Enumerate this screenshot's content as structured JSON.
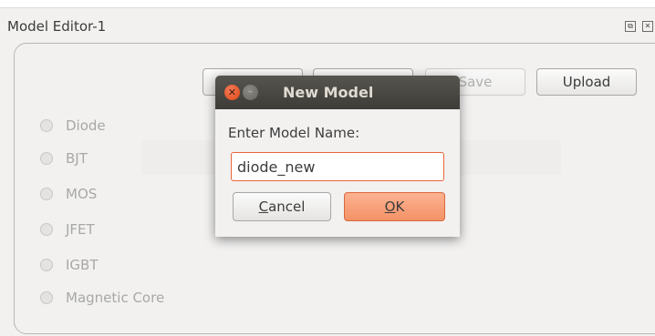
{
  "panel": {
    "title": "Model Editor-1",
    "float_glyph": "⧉",
    "close_glyph": "✕"
  },
  "toolbar": {
    "save_label": "Save",
    "upload_label": "Upload"
  },
  "model_types": [
    {
      "label": "Diode"
    },
    {
      "label": "BJT"
    },
    {
      "label": "MOS"
    },
    {
      "label": "JFET"
    },
    {
      "label": "IGBT"
    },
    {
      "label": "Magnetic Core"
    }
  ],
  "dialog": {
    "title": "New Model",
    "close_glyph": "✕",
    "minimize_glyph": "–",
    "prompt": "Enter Model Name:",
    "input_value": "diode_new",
    "cancel_mnemonic": "C",
    "cancel_rest": "ancel",
    "ok_mnemonic": "O",
    "ok_rest": "K"
  },
  "colors": {
    "accent": "#f39268",
    "focus_border": "#e9663a",
    "titlebar": "#3d3c38"
  }
}
